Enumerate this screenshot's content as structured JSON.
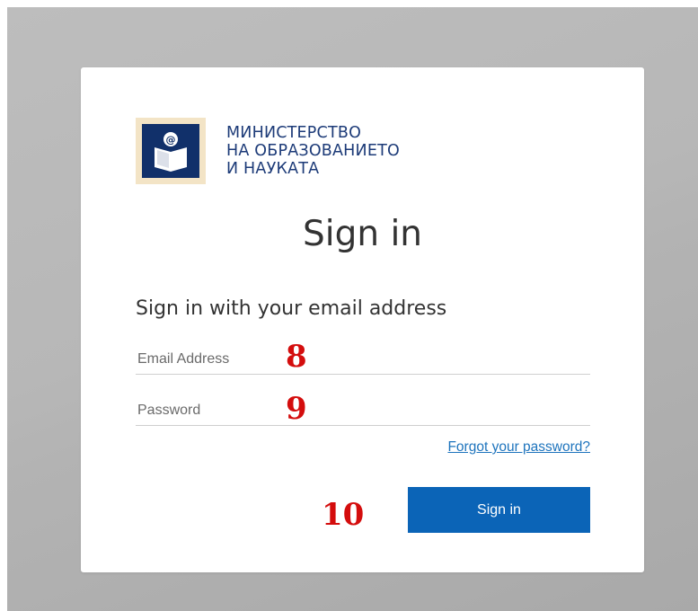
{
  "ministry": {
    "line1": "МИНИСТЕРСТВО",
    "line2": "НА ОБРАЗОВАНИЕТО",
    "line3": "И НАУКАТА"
  },
  "page_title": "Sign in",
  "form": {
    "subtitle": "Sign in with your email address",
    "email_placeholder": "Email Address",
    "password_placeholder": "Password",
    "forgot_link": "Forgot your password?",
    "submit_label": "Sign in"
  },
  "annotations": {
    "email_marker": "8",
    "password_marker": "9",
    "button_marker": "10"
  },
  "colors": {
    "accent": "#0b64b7",
    "link": "#1e74bd",
    "brand_text": "#1d3b78",
    "marker": "#d40d0d"
  }
}
